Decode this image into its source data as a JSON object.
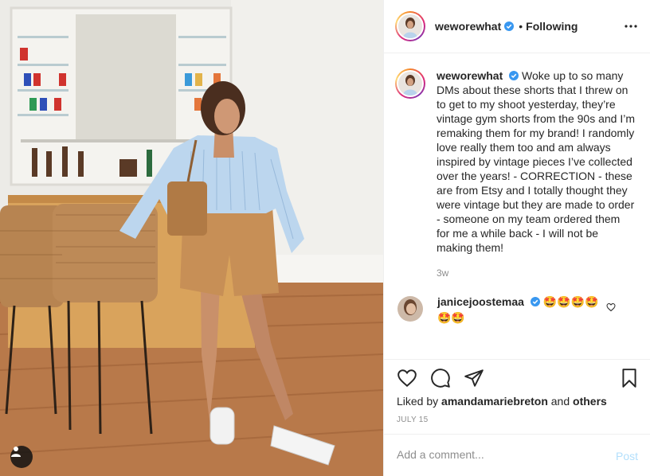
{
  "post": {
    "username": "weworewhat",
    "verified": true,
    "follow_state": "Following",
    "separator": "•",
    "caption": "Woke up to so many DMs about these shorts that I threw on to get to my shoot yesterday, they’re vintage gym shorts from the 90s and I’m remaking them for my brand! I randomly love really them too and am always inspired by vintage pieces I’ve collected over the years! - CORRECTION - these are from Etsy and I totally thought they were vintage but they are made to order - someone on my team ordered them for me a while back - I will not be making them!",
    "age": "3w"
  },
  "comments": [
    {
      "username": "janicejoostemaa",
      "verified": true,
      "text": "🤩🤩🤩🤩 🤩🤩"
    }
  ],
  "actions": {
    "liked_by_prefix": "Liked by",
    "liked_by_user": "amandamariebreton",
    "liked_by_joiner": "and",
    "liked_by_others": "others",
    "date": "JULY 15"
  },
  "add_comment": {
    "placeholder": "Add a comment...",
    "post_label": "Post"
  },
  "icons": {
    "more": "more-horizontal-icon",
    "like": "heart-icon",
    "comment": "comment-bubble-icon",
    "share": "paper-plane-icon",
    "save": "bookmark-icon",
    "user_tag": "user-tag-icon",
    "verified": "verified-badge-icon"
  },
  "colors": {
    "verified": "#3897f0",
    "post_button": "#b2dffc",
    "muted_text": "#8e8e8e",
    "border": "#efefef"
  }
}
